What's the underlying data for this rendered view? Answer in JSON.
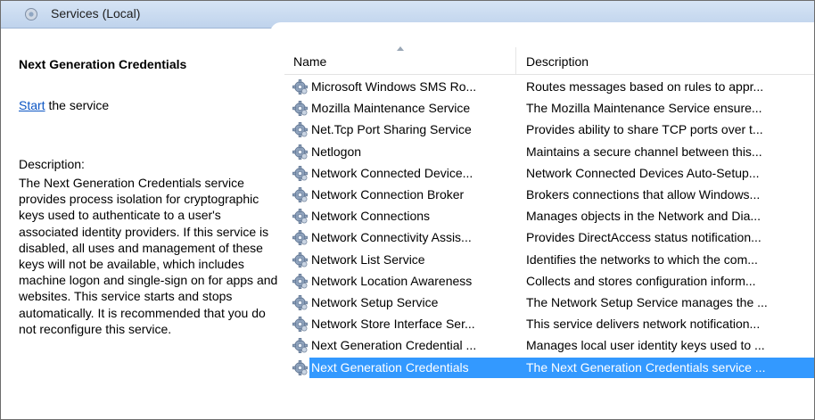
{
  "window": {
    "title": "Services (Local)"
  },
  "detail": {
    "service_name": "Next Generation Credentials",
    "start_link": "Start",
    "start_suffix": " the service",
    "description_label": "Description:",
    "description": "The Next Generation Credentials service provides process isolation for cryptographic keys used to authenticate to a user's associated identity providers. If this service is disabled, all uses and management of these keys will not be available, which includes machine logon and single-sign on for apps and websites. This service starts and stops automatically. It is recommended that you do not reconfigure this service."
  },
  "columns": {
    "name": "Name",
    "description": "Description"
  },
  "rows": [
    {
      "name": "Microsoft Windows SMS Ro...",
      "description": "Routes messages based on rules to appr...",
      "selected": false
    },
    {
      "name": "Mozilla Maintenance Service",
      "description": "The Mozilla Maintenance Service ensure...",
      "selected": false
    },
    {
      "name": "Net.Tcp Port Sharing Service",
      "description": "Provides ability to share TCP ports over t...",
      "selected": false
    },
    {
      "name": "Netlogon",
      "description": "Maintains a secure channel between this...",
      "selected": false
    },
    {
      "name": "Network Connected Device...",
      "description": "Network Connected Devices Auto-Setup...",
      "selected": false
    },
    {
      "name": "Network Connection Broker",
      "description": "Brokers connections that allow Windows...",
      "selected": false
    },
    {
      "name": "Network Connections",
      "description": "Manages objects in the Network and Dia...",
      "selected": false
    },
    {
      "name": "Network Connectivity Assis...",
      "description": "Provides DirectAccess status notification...",
      "selected": false
    },
    {
      "name": "Network List Service",
      "description": "Identifies the networks to which the com...",
      "selected": false
    },
    {
      "name": "Network Location Awareness",
      "description": "Collects and stores configuration inform...",
      "selected": false
    },
    {
      "name": "Network Setup Service",
      "description": "The Network Setup Service manages the ...",
      "selected": false
    },
    {
      "name": "Network Store Interface Ser...",
      "description": "This service delivers network notification...",
      "selected": false
    },
    {
      "name": "Next Generation Credential ...",
      "description": "Manages local user identity keys used to ...",
      "selected": false
    },
    {
      "name": "Next Generation Credentials",
      "description": "The Next Generation Credentials service ...",
      "selected": true
    }
  ],
  "colors": {
    "selection": "#3399ff",
    "link": "#0b55c4",
    "titlebar": "#c9dbf0"
  },
  "icons": {
    "row_icon": "gear-icon",
    "title_icon": "gear-icon"
  }
}
